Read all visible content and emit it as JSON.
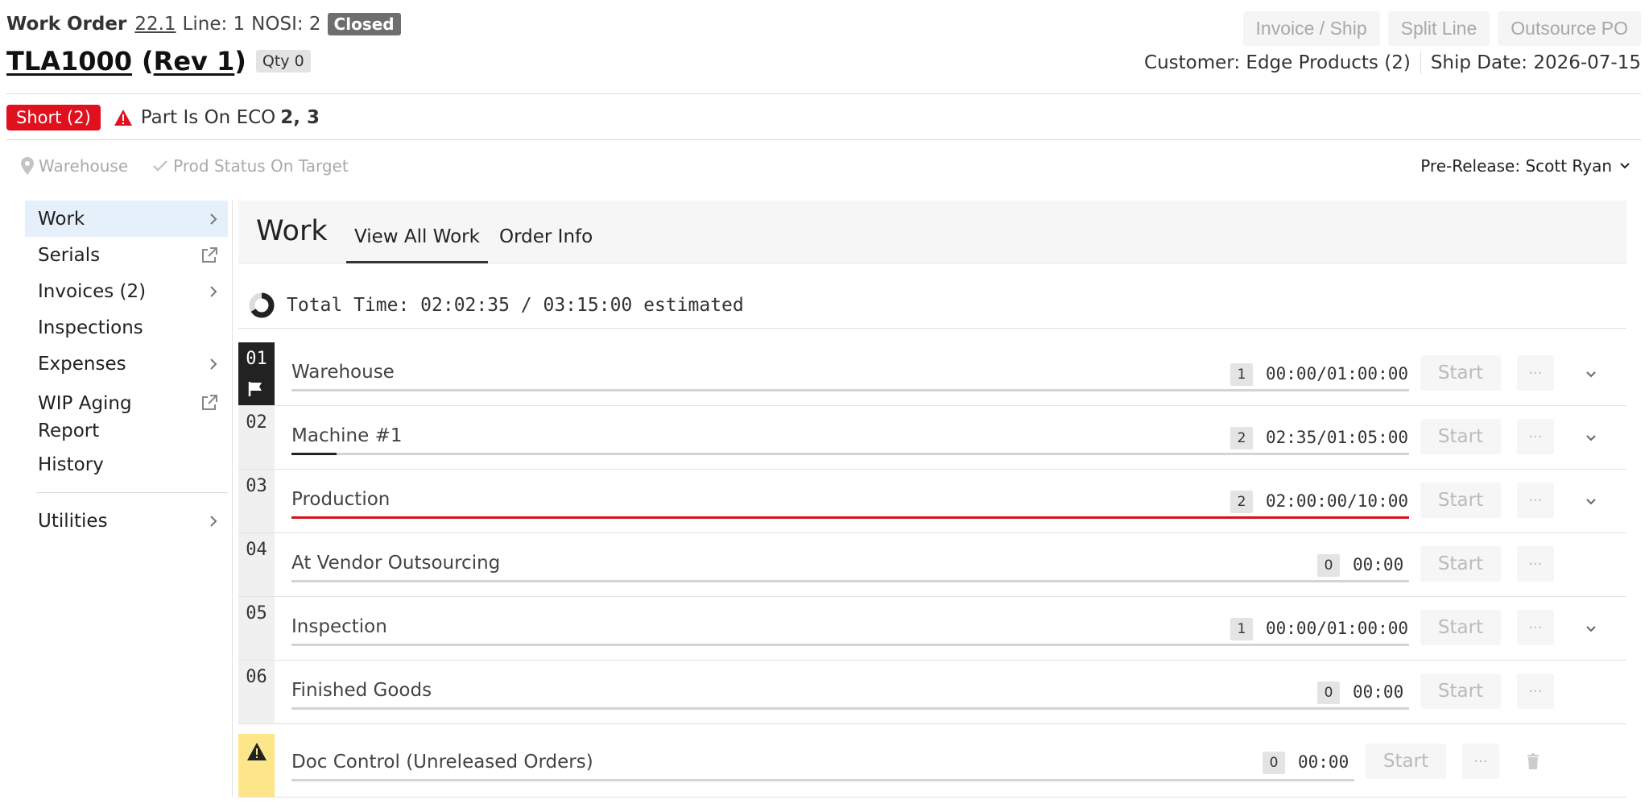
{
  "header": {
    "work_order_label": "Work Order",
    "work_order_num": "22.1",
    "line": "Line: 1",
    "nosi": "NOSI: 2",
    "status": "Closed",
    "part": "TLA1000",
    "rev_open": "(",
    "rev": "Rev 1",
    "rev_close": ")",
    "qty": "Qty 0",
    "customer": "Customer: Edge Products (2)",
    "ship_date": "Ship Date: 2026-07-15"
  },
  "actions": [
    "Invoice / Ship",
    "Split Line",
    "Outsource PO"
  ],
  "alerts": {
    "short": "Short (2)",
    "eco_text": "Part Is On ECO",
    "eco_nums": "2, 3"
  },
  "status_row": {
    "location": "Warehouse",
    "prod_status": "Prod Status On Target",
    "pre_release": "Pre-Release: Scott Ryan"
  },
  "sidebar": {
    "items": [
      {
        "label": "Work",
        "icon": "chevron-right-icon"
      },
      {
        "label": "Serials",
        "icon": "external-link-icon"
      },
      {
        "label": "Invoices (2)",
        "icon": "chevron-right-icon"
      },
      {
        "label": "Inspections",
        "icon": ""
      },
      {
        "label": "Expenses",
        "icon": "chevron-right-icon"
      },
      {
        "label": "WIP Aging Report",
        "icon": "external-link-icon"
      },
      {
        "label": "History",
        "icon": ""
      },
      {
        "label": "Utilities",
        "icon": "chevron-right-icon"
      }
    ]
  },
  "main": {
    "title": "Work",
    "tabs": [
      "View All Work",
      "Order Info"
    ],
    "total_time": "Total Time: 02:02:35 / 03:15:00 estimated",
    "total_progress": 0.66
  },
  "ops": [
    {
      "num": "01",
      "name": "Warehouse",
      "count": "1",
      "time": "00:00/01:00:00",
      "start": "Start",
      "more": "···",
      "progress": 0,
      "over": false
    },
    {
      "num": "02",
      "name": "Machine #1",
      "count": "2",
      "time": "02:35/01:05:00",
      "start": "Start",
      "more": "···",
      "progress": 0.04,
      "over": false
    },
    {
      "num": "03",
      "name": "Production",
      "count": "2",
      "time": "02:00:00/10:00",
      "start": "Start",
      "more": "···",
      "progress": 1,
      "over": true
    },
    {
      "num": "04",
      "name": "At Vendor Outsourcing",
      "count": "0",
      "time": "00:00",
      "start": "Start",
      "more": "···",
      "progress": 0,
      "over": false
    },
    {
      "num": "05",
      "name": "Inspection",
      "count": "1",
      "time": "00:00/01:00:00",
      "start": "Start",
      "more": "···",
      "progress": 0,
      "over": false
    },
    {
      "num": "06",
      "name": "Finished Goods",
      "count": "0",
      "time": "00:00",
      "start": "Start",
      "more": "···",
      "progress": 0,
      "over": false
    }
  ],
  "doc_control": {
    "name": "Doc Control (Unreleased Orders)",
    "count": "0",
    "time": "00:00",
    "start": "Start",
    "more": "···"
  },
  "colors": {
    "accent_red": "#e0101d",
    "active_bg": "#e5f0fb",
    "warning_yellow": "#fde58a"
  }
}
